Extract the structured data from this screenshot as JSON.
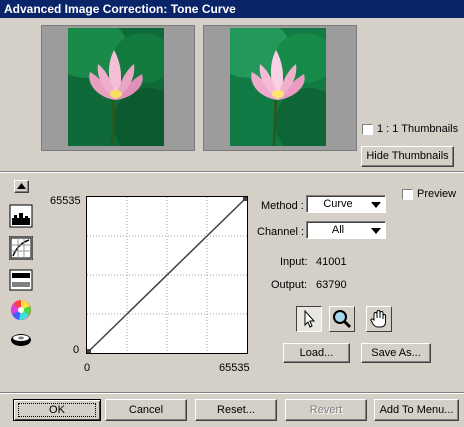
{
  "window": {
    "title": "Advanced Image Correction: Tone Curve"
  },
  "thumbnails": {
    "one_to_one_label": "1 : 1 Thumbnails",
    "one_to_one_checked": false,
    "hide_label": "Hide Thumbnails"
  },
  "preview": {
    "label": "Preview",
    "checked": false
  },
  "curve": {
    "y_max_label": "65535",
    "y_min_label": "0",
    "x_min_label": "0",
    "x_max_label": "65535"
  },
  "method": {
    "label": "Method :",
    "value": "Curve"
  },
  "channel": {
    "label": "Channel :",
    "value": "All"
  },
  "readout": {
    "input_label": "Input:",
    "input_value": "41001",
    "output_label": "Output:",
    "output_value": "63790"
  },
  "tools": [
    "pointer-icon",
    "zoom-icon",
    "hand-icon"
  ],
  "buttons": {
    "load": "Load...",
    "save_as": "Save As...",
    "ok": "OK",
    "cancel": "Cancel",
    "reset": "Reset...",
    "revert": "Revert",
    "add_to_menu": "Add To Menu..."
  }
}
